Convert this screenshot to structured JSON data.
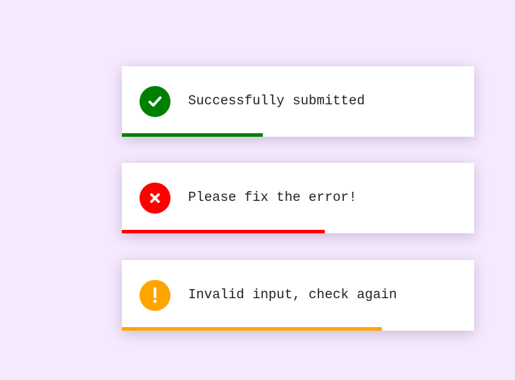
{
  "toasts": [
    {
      "kind": "success",
      "message": "Successfully submitted",
      "icon": "check-icon",
      "color": "#008000",
      "progress": 0.4
    },
    {
      "kind": "error",
      "message": "Please fix the error!",
      "icon": "x-icon",
      "color": "#ff0000",
      "progress": 0.575
    },
    {
      "kind": "warning",
      "message": "Invalid input, check again",
      "icon": "exclamation-icon",
      "color": "#ffa500",
      "progress": 0.738
    }
  ]
}
